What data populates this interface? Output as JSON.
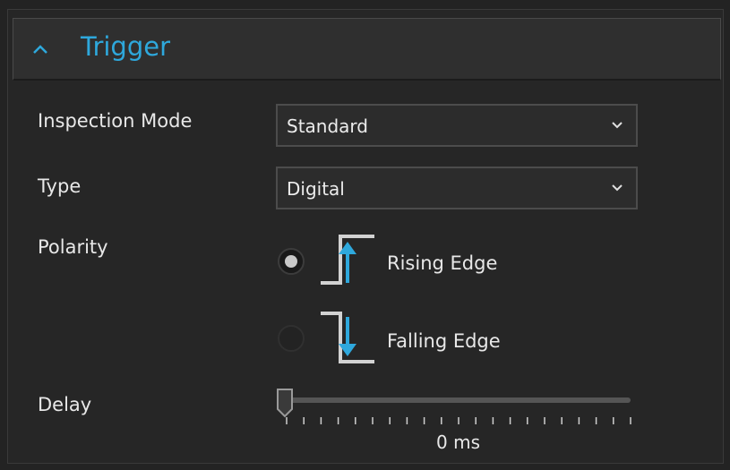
{
  "section": {
    "title": "Trigger",
    "collapse_icon": "chevron-up-icon",
    "accent_color": "#2ea8dc"
  },
  "fields": {
    "inspection_mode": {
      "label": "Inspection Mode",
      "value": "Standard"
    },
    "type": {
      "label": "Type",
      "value": "Digital"
    },
    "polarity": {
      "label": "Polarity",
      "options": [
        {
          "label": "Rising Edge",
          "icon": "rising-edge-icon",
          "selected": true
        },
        {
          "label": "Falling Edge",
          "icon": "falling-edge-icon",
          "selected": false
        }
      ]
    },
    "delay": {
      "label": "Delay",
      "value": 0,
      "readout": "0 ms"
    }
  }
}
